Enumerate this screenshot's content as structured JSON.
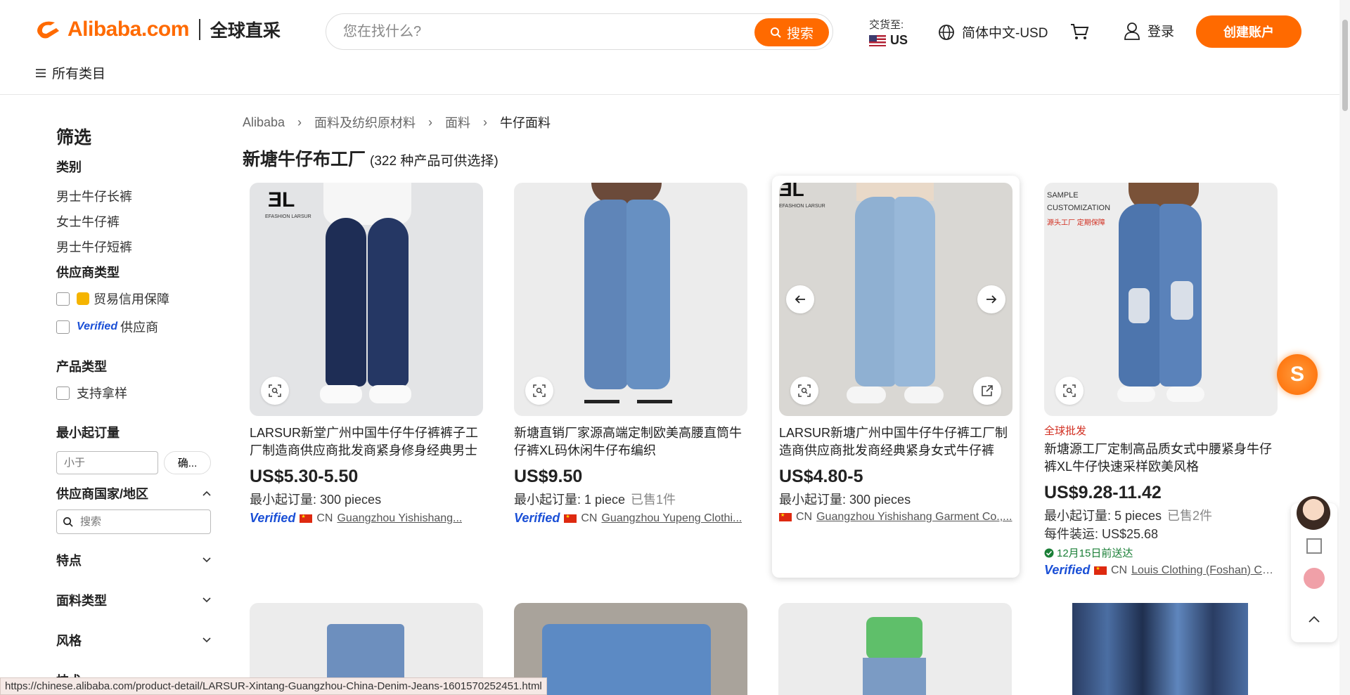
{
  "header": {
    "logo_text": "Alibaba.com",
    "logo_sub": "全球直采",
    "search_placeholder": "您在找什么?",
    "search_button": "搜索",
    "ship_label": "交货至:",
    "ship_country": "US",
    "language": "简体中文-USD",
    "login": "登录",
    "signup": "创建账户",
    "all_categories": "所有类目"
  },
  "sidebar": {
    "title": "筛选",
    "category_heading": "类别",
    "categories": [
      "男士牛仔长裤",
      "女士牛仔裤",
      "男士牛仔短裤"
    ],
    "supplier_type_heading": "供应商类型",
    "supplier_trade": "贸易信用保障",
    "supplier_verified_word": "Verified",
    "supplier_verified_suffix": "供应商",
    "product_type_heading": "产品类型",
    "product_type_option": "支持拿样",
    "moq_heading": "最小起订量",
    "moq_placeholder": "小于",
    "moq_confirm": "确...",
    "region_heading": "供应商国家/地区",
    "region_search_placeholder": "搜索",
    "features_heading": "特点",
    "fabric_heading": "面料类型",
    "style_heading": "风格",
    "tech_heading": "技术"
  },
  "breadcrumbs": [
    "Alibaba",
    "面料及纺织原材料",
    "面料",
    "牛仔面料"
  ],
  "page_title": "新塘牛仔布工厂",
  "page_count": "(322 种产品可供选择)",
  "products": [
    {
      "title": "LARSUR新堂广州中国牛仔牛仔裤裤子工厂制造商供应商批发商紧身修身经典男士牛...",
      "price": "US$5.30-5.50",
      "moq": "最小起订量: 300 pieces",
      "sold": "",
      "verified": "Verified",
      "country": "CN",
      "supplier": "Guangzhou Yishishang..."
    },
    {
      "title": "新塘直销厂家源高端定制欧美高腰直筒牛仔裤XL码休闲牛仔布编织",
      "price": "US$9.50",
      "moq": "最小起订量: 1 piece",
      "sold": "已售1件",
      "verified": "Verified",
      "country": "CN",
      "supplier": "Guangzhou Yupeng Clothi..."
    },
    {
      "title": "LARSUR新塘广州中国牛仔牛仔裤工厂制造商供应商批发商经典紧身女式牛仔裤",
      "price": "US$4.80-5",
      "moq": "最小起订量: 300 pieces",
      "sold": "",
      "verified": "",
      "country": "CN",
      "supplier": "Guangzhou Yishishang Garment Co.,..."
    },
    {
      "badge": "全球批发",
      "title": "新塘源工厂定制高品质女式中腰紧身牛仔裤XL牛仔快速采样欧美风格",
      "price": "US$9.28-11.42",
      "moq": "最小起订量: 5 pieces",
      "sold": "已售2件",
      "shipping": "每件装运: US$25.68",
      "delivery": "12月15日前送达",
      "verified": "Verified",
      "country": "CN",
      "supplier": "Louis Clothing (Foshan) Co...."
    }
  ],
  "image_text": {
    "brand_el": "EFASHION LARSUR",
    "sample_line1": "SAMPLE",
    "sample_line2": "CUSTOMIZATION",
    "sample_red": "源头工厂 定期保障"
  },
  "status_url": "https://chinese.alibaba.com/product-detail/LARSUR-Xintang-Guangzhou-China-Denim-Jeans-1601570252451.html",
  "float_badge": "S",
  "colors": {
    "accent": "#ff6a00",
    "verified": "#1a4fd6",
    "badge_red": "#d12d1f",
    "delivery_green": "#1a7f37"
  }
}
